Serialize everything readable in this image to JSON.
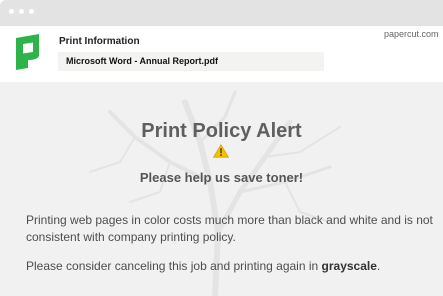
{
  "window": {
    "titlebar_dots": 3
  },
  "header": {
    "title": "Print Information",
    "domain": "papercut.com",
    "document_name": "Microsoft Word - Annual Report.pdf",
    "logo_color": "#2db34a"
  },
  "alert": {
    "heading": "Print Policy Alert",
    "subheading": "Please help us save toner!",
    "paragraph1": "Printing web pages in color costs much more than black and white and is not consistent with company printing policy.",
    "paragraph2_prefix": "Please consider canceling this job and printing again in ",
    "paragraph2_emphasis": "grayscale",
    "paragraph2_suffix": ".",
    "warning_icon": "warning-triangle-icon",
    "warning_color": "#f2c200"
  }
}
